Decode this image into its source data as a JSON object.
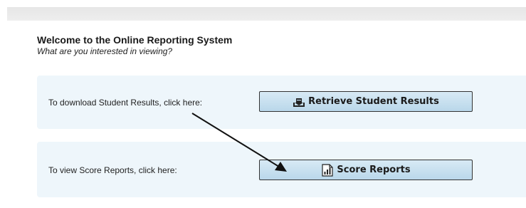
{
  "header": {
    "title": "Welcome to the Online Reporting System",
    "subtitle": "What are you interested in viewing?"
  },
  "panels": [
    {
      "label": "To download Student Results, click here:",
      "button_label": "Retrieve Student Results",
      "icon": "download-tray-icon"
    },
    {
      "label": "To view Score Reports, click here:",
      "button_label": "Score Reports",
      "icon": "bar-chart-icon"
    }
  ],
  "colors": {
    "panel_background": "#eef6fb",
    "button_background": "#c5e0f0",
    "top_bar": "#e8e8e8"
  }
}
